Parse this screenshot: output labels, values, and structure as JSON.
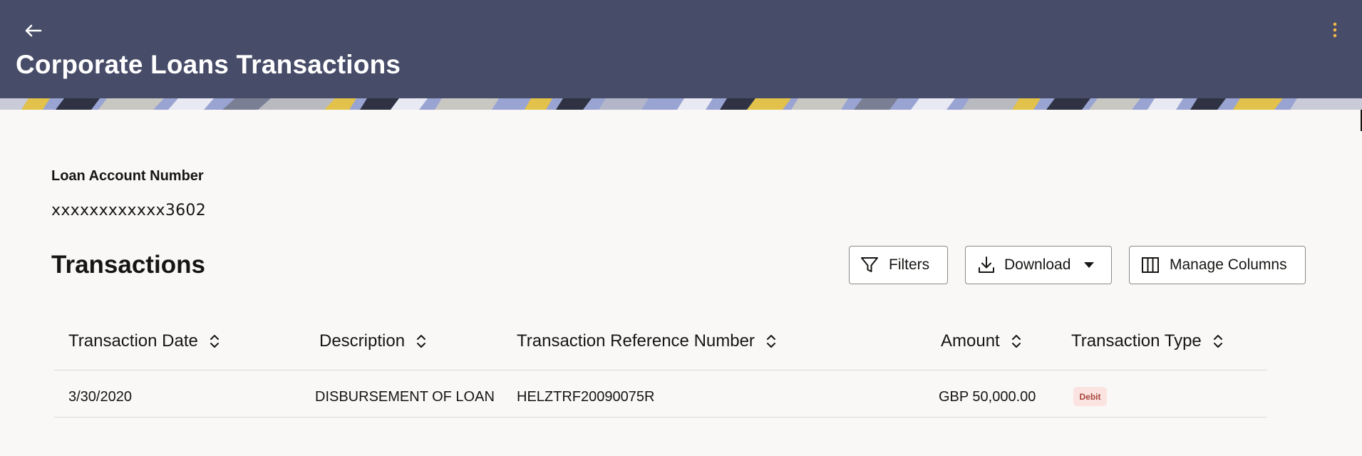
{
  "header": {
    "title": "Corporate Loans Transactions",
    "back_icon": "arrow-left-icon",
    "menu_icon": "kebab-menu-icon",
    "background_color": "#474c68",
    "menu_icon_color": "#f0b84a"
  },
  "account": {
    "label": "Loan Account Number",
    "value": "xxxxxxxxxxxx3602"
  },
  "transactions": {
    "title": "Transactions",
    "toolbar": {
      "filters_label": "Filters",
      "filters_icon": "filter-icon",
      "download_label": "Download",
      "download_icon": "download-icon",
      "download_caret_icon": "caret-down-icon",
      "manage_columns_label": "Manage Columns",
      "manage_columns_icon": "columns-icon"
    },
    "columns": [
      {
        "label": "Transaction Date",
        "sort_icon": "sort-icon"
      },
      {
        "label": "Description",
        "sort_icon": "sort-icon"
      },
      {
        "label": "Transaction Reference Number",
        "sort_icon": "sort-icon"
      },
      {
        "label": "Amount",
        "sort_icon": "sort-icon"
      },
      {
        "label": "Transaction Type",
        "sort_icon": "sort-icon"
      }
    ],
    "rows": [
      {
        "date": "3/30/2020",
        "description": "DISBURSEMENT OF LOAN",
        "reference": "HELZTRF20090075R",
        "amount": "GBP 50,000.00",
        "type": "Debit"
      }
    ],
    "badge_colors": {
      "debit_bg": "#fbe3e1",
      "debit_text": "#a8453b"
    }
  }
}
